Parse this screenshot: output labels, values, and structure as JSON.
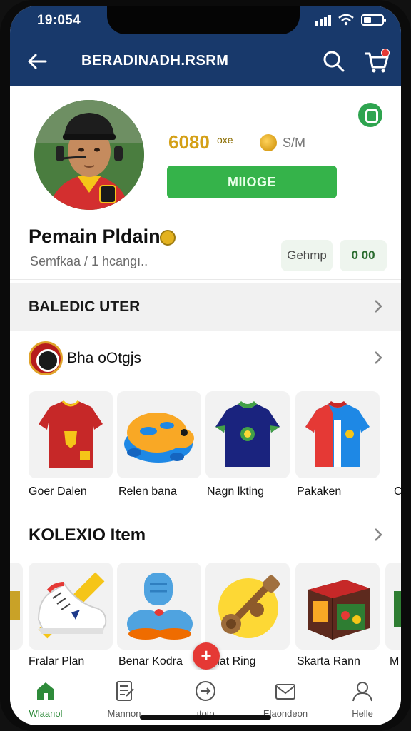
{
  "status_bar": {
    "time": "19:054"
  },
  "header": {
    "title": "BERADINADH.RSRM"
  },
  "profile": {
    "coins": "6080",
    "coins_unit": "oxe",
    "token_label": "S/M",
    "message_button": "MIIOGE",
    "name": "Pemain Pldain",
    "subtitle": "Semfkaa / 1 hcangı..",
    "stat_a": "Gehmp",
    "stat_b": "0 00"
  },
  "sections": {
    "section1": "BALEDIC UTER",
    "section2": "Bha oOtgjs",
    "section3": "KOLEXIO Item"
  },
  "row1": [
    {
      "label": "Goer Dalen",
      "icon": "red-jersey-icon"
    },
    {
      "label": "Relen bana",
      "icon": "toy-frog-icon"
    },
    {
      "label": "Nagn lkting",
      "icon": "green-jersey-icon"
    },
    {
      "label": "Pakaken",
      "icon": "blue-red-jersey-icon"
    }
  ],
  "row1_partial": "C",
  "row2": [
    {
      "label": "Fralar Plan",
      "icon": "sneaker-icon"
    },
    {
      "label": "Benar Kodra",
      "icon": "plush-icon"
    },
    {
      "label": "ohat Ring",
      "icon": "trumpet-icon"
    },
    {
      "label": "Skarta Rann",
      "icon": "box-icon"
    }
  ],
  "row2_partial": "M",
  "fab_label": "+",
  "bottom_nav": [
    {
      "label": "Wlaanol",
      "icon": "home-icon",
      "active": true
    },
    {
      "label": "Mannon",
      "icon": "notebook-icon",
      "active": false
    },
    {
      "label": "ıtoto",
      "icon": "compass-icon",
      "active": false
    },
    {
      "label": "Elaondeon",
      "icon": "inbox-icon",
      "active": false
    },
    {
      "label": "Helle",
      "icon": "person-icon",
      "active": false
    }
  ],
  "colors": {
    "header": "#18396b",
    "accent_green": "#35b34a",
    "badge_red": "#e53935",
    "coin_gold": "#d4a017"
  }
}
